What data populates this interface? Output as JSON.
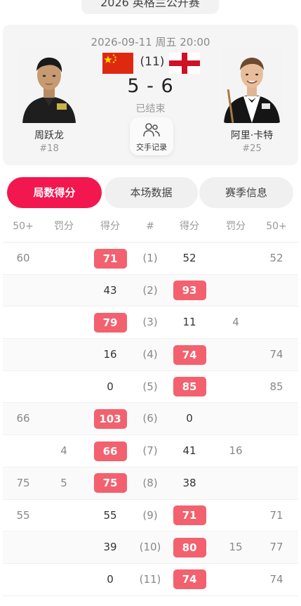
{
  "event_title": "2026 英格兰公开赛",
  "match": {
    "datetime": "2026-09-11 周五 20:00",
    "frames_total": "(11)",
    "score": "5 - 6",
    "status": "已结束",
    "head_to_head_label": "交手记录"
  },
  "players": {
    "left": {
      "name": "周跃龙",
      "rank": "#18",
      "flag": "china-flag"
    },
    "right": {
      "name": "阿里·卡特",
      "rank": "#25",
      "flag": "england-flag"
    }
  },
  "tabs": [
    "局数得分",
    "本场数据",
    "赛季信息"
  ],
  "table": {
    "headers": [
      "50+",
      "罚分",
      "得分",
      "#",
      "得分",
      "罚分",
      "50+"
    ],
    "rows": [
      {
        "l50": "60",
        "lpen": "",
        "lscore": "71",
        "frame": "(1)",
        "rscore": "52",
        "rpen": "",
        "r50": "52",
        "winner": "left"
      },
      {
        "l50": "",
        "lpen": "",
        "lscore": "43",
        "frame": "(2)",
        "rscore": "93",
        "rpen": "",
        "r50": "",
        "winner": "right"
      },
      {
        "l50": "",
        "lpen": "",
        "lscore": "79",
        "frame": "(3)",
        "rscore": "11",
        "rpen": "4",
        "r50": "",
        "winner": "left"
      },
      {
        "l50": "",
        "lpen": "",
        "lscore": "16",
        "frame": "(4)",
        "rscore": "74",
        "rpen": "",
        "r50": "74",
        "winner": "right"
      },
      {
        "l50": "",
        "lpen": "",
        "lscore": "0",
        "frame": "(5)",
        "rscore": "85",
        "rpen": "",
        "r50": "85",
        "winner": "right"
      },
      {
        "l50": "66",
        "lpen": "",
        "lscore": "103",
        "frame": "(6)",
        "rscore": "0",
        "rpen": "",
        "r50": "",
        "winner": "left"
      },
      {
        "l50": "",
        "lpen": "4",
        "lscore": "66",
        "frame": "(7)",
        "rscore": "41",
        "rpen": "16",
        "r50": "",
        "winner": "left"
      },
      {
        "l50": "75",
        "lpen": "5",
        "lscore": "75",
        "frame": "(8)",
        "rscore": "38",
        "rpen": "",
        "r50": "",
        "winner": "left"
      },
      {
        "l50": "55",
        "lpen": "",
        "lscore": "55",
        "frame": "(9)",
        "rscore": "71",
        "rpen": "",
        "r50": "71",
        "winner": "right"
      },
      {
        "l50": "",
        "lpen": "",
        "lscore": "39",
        "frame": "(10)",
        "rscore": "80",
        "rpen": "15",
        "r50": "77",
        "winner": "right"
      },
      {
        "l50": "",
        "lpen": "",
        "lscore": "0",
        "frame": "(11)",
        "rscore": "74",
        "rpen": "",
        "r50": "74",
        "winner": "right"
      }
    ]
  },
  "colors": {
    "accent": "#f2174e",
    "winner_pill": "#f3616e"
  }
}
